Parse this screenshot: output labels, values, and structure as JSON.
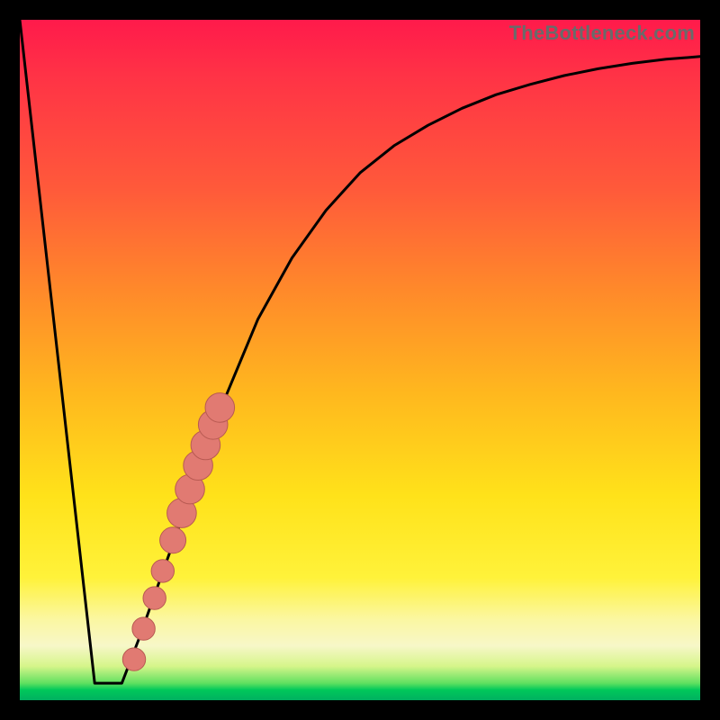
{
  "watermark": "TheBottleneck.com",
  "colors": {
    "frame": "#000000",
    "curve": "#000000",
    "marker_fill": "#e17a72",
    "marker_stroke": "#b85a52"
  },
  "chart_data": {
    "type": "line",
    "title": "",
    "xlabel": "",
    "ylabel": "",
    "xlim": [
      0,
      100
    ],
    "ylim": [
      0,
      100
    ],
    "grid": false,
    "legend": false,
    "series": [
      {
        "name": "left-descent",
        "x": [
          0,
          11
        ],
        "y": [
          100,
          2.5
        ]
      },
      {
        "name": "floor",
        "x": [
          11,
          15
        ],
        "y": [
          2.5,
          2.5
        ]
      },
      {
        "name": "right-ascend-curve",
        "x": [
          15,
          17.5,
          20,
          22.5,
          25,
          27.5,
          30,
          32.5,
          35,
          40,
          45,
          50,
          55,
          60,
          65,
          70,
          75,
          80,
          85,
          90,
          95,
          100
        ],
        "y": [
          2.5,
          9,
          16,
          23,
          30,
          37,
          44,
          50,
          56,
          65,
          72,
          77.5,
          81.5,
          84.5,
          87,
          89,
          90.5,
          91.8,
          92.8,
          93.6,
          94.2,
          94.6
        ]
      }
    ],
    "markers": [
      {
        "x": 16.8,
        "y": 6.0,
        "r": 1.4
      },
      {
        "x": 18.2,
        "y": 10.5,
        "r": 1.4
      },
      {
        "x": 19.8,
        "y": 15.0,
        "r": 1.4
      },
      {
        "x": 21.0,
        "y": 19.0,
        "r": 1.4
      },
      {
        "x": 22.5,
        "y": 23.5,
        "r": 1.6
      },
      {
        "x": 23.8,
        "y": 27.5,
        "r": 1.8
      },
      {
        "x": 25.0,
        "y": 31.0,
        "r": 1.8
      },
      {
        "x": 26.2,
        "y": 34.5,
        "r": 1.8
      },
      {
        "x": 27.3,
        "y": 37.5,
        "r": 1.8
      },
      {
        "x": 28.4,
        "y": 40.5,
        "r": 1.8
      },
      {
        "x": 29.4,
        "y": 43.0,
        "r": 1.8
      }
    ]
  }
}
